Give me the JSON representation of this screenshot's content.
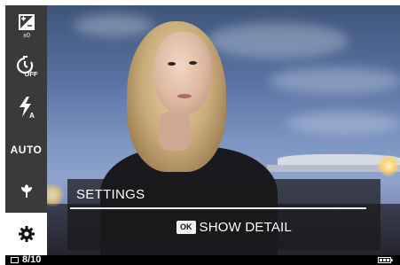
{
  "left_menu": {
    "items": [
      {
        "icon": "exposure-compensation-icon",
        "sublabel": "±0"
      },
      {
        "icon": "self-timer-icon",
        "sublabel": "OFF"
      },
      {
        "icon": "flash-icon",
        "sublabel": "A"
      },
      {
        "label": "AUTO"
      },
      {
        "icon": "macro-icon"
      },
      {
        "icon": "settings-gear-icon",
        "selected": true
      }
    ]
  },
  "overlay": {
    "title": "SETTINGS",
    "ok_key": "OK",
    "action_label": "SHOW DETAIL"
  },
  "status_bar": {
    "frame_count": "8/10",
    "battery_icon": "battery-full-icon"
  },
  "colors": {
    "strip_background": "#3a3a3a",
    "selected_background": "#ffffff",
    "overlay_background": "rgba(25,25,28,0.72)",
    "status_bar_background": "#000000"
  }
}
